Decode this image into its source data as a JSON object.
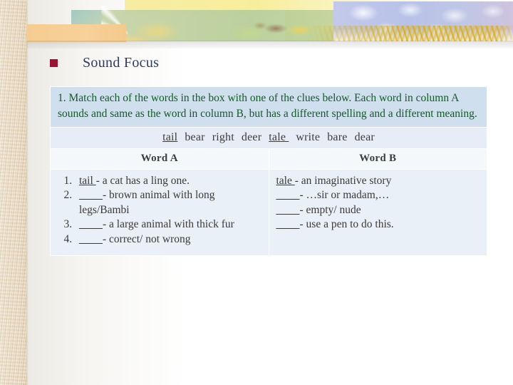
{
  "slide": {
    "title": "Sound Focus",
    "bullet_color": "#9e1030",
    "title_color": "#2d3c63"
  },
  "instruction": {
    "text": "1. Match each of the words in the box with one of the clues below. Each word in column A sounds and same as the word in column B, but has a different spelling and a different meaning.",
    "text_color": "#125a25",
    "background": "#cfdfed"
  },
  "word_box": {
    "words": [
      {
        "text": "tail",
        "underlined": true
      },
      {
        "text": "bear",
        "underlined": false
      },
      {
        "text": "right",
        "underlined": false
      },
      {
        "text": "deer",
        "underlined": false
      },
      {
        "text": "tale ",
        "underlined": true
      },
      {
        "text": "write",
        "underlined": false
      },
      {
        "text": "bare",
        "underlined": false
      },
      {
        "text": "dear",
        "underlined": false
      }
    ],
    "background": "#e7edf7"
  },
  "columns": {
    "header_a": "Word A",
    "header_b": "Word B",
    "header_background": "#f5f8fb",
    "body_background": "#eaf0f8"
  },
  "column_a": {
    "items": [
      {
        "number": "1.",
        "answer": "tail ",
        "answer_filled": true,
        "blank": "____",
        "clue": " - a cat has a ling one."
      },
      {
        "number": "2.",
        "answer": "",
        "answer_filled": false,
        "blank": "____",
        "clue": "- brown animal with long legs/Bambi"
      },
      {
        "number": "3.",
        "answer": "",
        "answer_filled": false,
        "blank": "____",
        "clue": "- a large animal with thick fur"
      },
      {
        "number": "4.",
        "answer": "",
        "answer_filled": false,
        "blank": "____",
        "clue": "- correct/ not wrong"
      }
    ]
  },
  "column_b": {
    "items": [
      {
        "answer": "tale ",
        "answer_filled": true,
        "blank": "____",
        "clue": " - an imaginative story"
      },
      {
        "answer": "",
        "answer_filled": false,
        "blank": "____",
        "clue": "- …sir or madam,…"
      },
      {
        "answer": "",
        "answer_filled": false,
        "blank": "____",
        "clue": "- empty/ nude"
      },
      {
        "answer": "",
        "answer_filled": false,
        "blank": "____",
        "clue": "- use a pen to do this."
      }
    ]
  }
}
